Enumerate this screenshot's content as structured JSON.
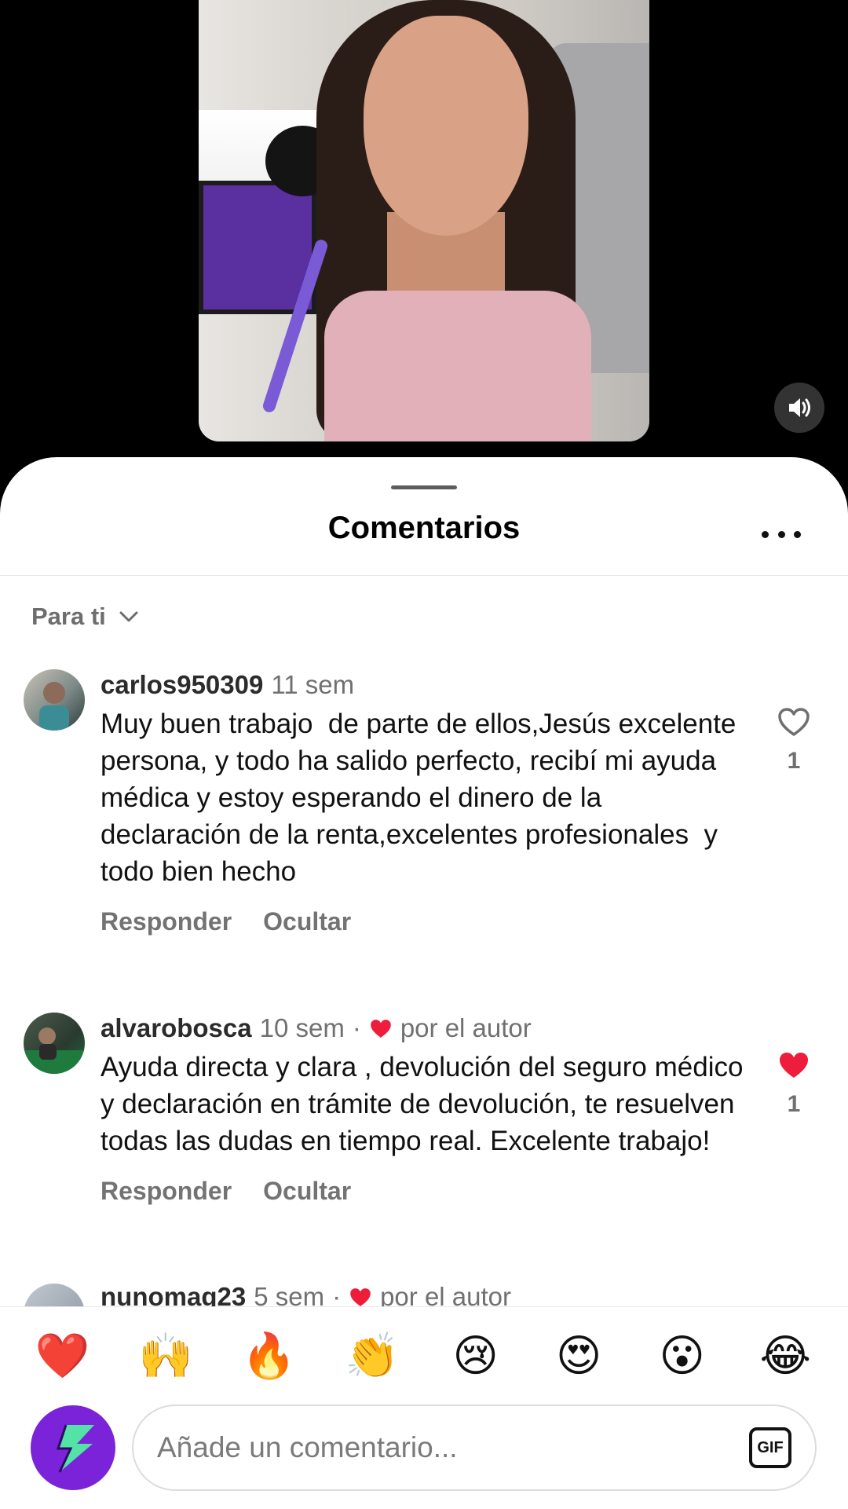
{
  "sheet": {
    "title": "Comentarios",
    "sort_label": "Para ti"
  },
  "comments": [
    {
      "user": "carlos950309",
      "time": "11 sem",
      "text": "Muy buen trabajo  de parte de ellos,Jesús excelente persona, y todo ha salido perfecto, recibí mi ayuda médica y estoy esperando el dinero de la declaración de la renta,excelentes profesionales  y todo bien hecho",
      "reply_label": "Responder",
      "hide_label": "Ocultar",
      "likes": "1",
      "liked": false
    },
    {
      "user": "alvarobosca",
      "time": "10 sem",
      "separator": "·",
      "author_label": "por el autor",
      "text": "Ayuda directa y clara , devolución del seguro médico y declaración en trámite de devolución, te resuelven todas las dudas en tiempo real. Excelente trabajo!",
      "reply_label": "Responder",
      "hide_label": "Ocultar",
      "likes": "1",
      "liked": true
    },
    {
      "user": "nunomag23",
      "time": "5 sem",
      "separator": "·",
      "author_label": "por el autor"
    }
  ],
  "reactions": [
    "❤️",
    "🙌",
    "🔥",
    "👏",
    "😢",
    "😍",
    "😮",
    "😂"
  ],
  "composer": {
    "placeholder": "Añade un comentario...",
    "gif_label": "GIF"
  },
  "colors": {
    "like_red": "#ee1d3b",
    "app_purple": "#7b23d9",
    "app_green": "#53e3a6"
  },
  "icons": {
    "sound": "speaker-icon",
    "more": "more-icon",
    "sort_chevron": "chevron-down-icon",
    "like": "heart-icon"
  }
}
